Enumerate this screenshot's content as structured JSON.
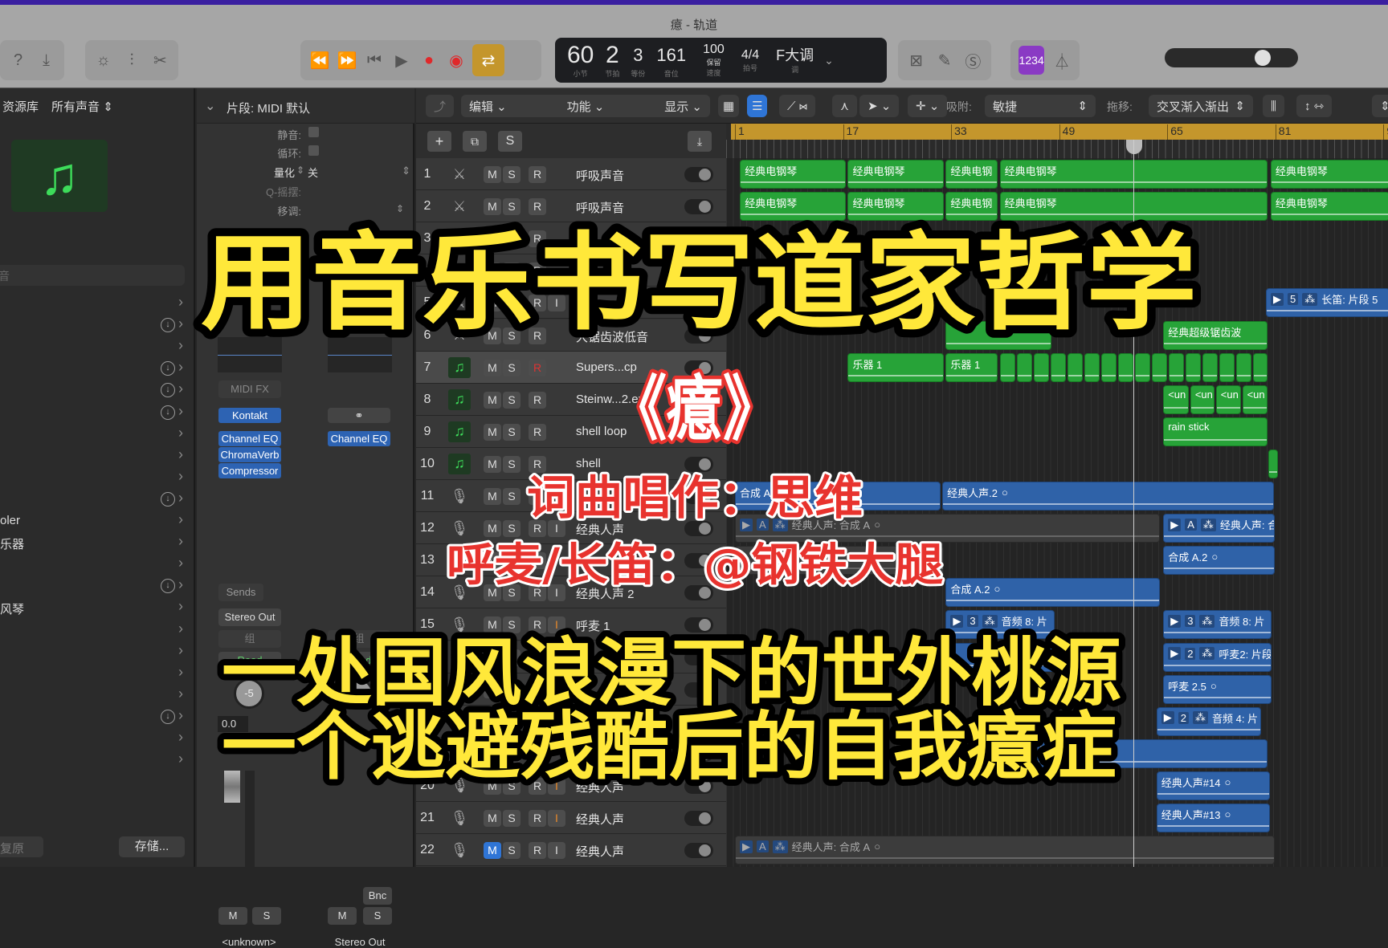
{
  "window": {
    "title": "癔 - 轨道"
  },
  "colors": {
    "accent_green": "#27a338",
    "region_blue": "#2f62a8",
    "cycle_gold": "#c4962c",
    "overlay_yellow": "#ffe83a",
    "overlay_red": "#e8332e"
  },
  "toolbar": {
    "icons": [
      "help-icon",
      "download-icon",
      "brightness-icon",
      "mixer-icon",
      "scissors-icon",
      "rewind-icon",
      "fast-forward-icon",
      "go-to-start-icon",
      "play-icon",
      "record-icon",
      "replace-record-icon",
      "cycle-icon",
      "tuner-icon",
      "pencil-icon",
      "score-icon",
      "count-in-icon",
      "metronome-icon"
    ],
    "count_in": "1234",
    "lcd": {
      "bar": "60",
      "bar_label": "小节",
      "beat": "2",
      "beat_label": "节拍",
      "div": "3",
      "div_label": "等份",
      "tick": "161",
      "tick_label": "音位",
      "tempo": "100",
      "tempo_mode": "保留",
      "tempo_label": "速度",
      "sig_top": "4",
      "sig_bottom": "4",
      "sig_label": "拍号",
      "key": "F大调",
      "key_label": "调"
    },
    "master_volume": 0.7
  },
  "library": {
    "title": "资源库",
    "filter": "所有声音",
    "search_placeholder": "音",
    "items": [
      {
        "label": ""
      },
      {
        "label": ""
      },
      {
        "label": ""
      },
      {
        "label": ""
      },
      {
        "label": ""
      },
      {
        "label": ""
      },
      {
        "label": ""
      },
      {
        "label": ""
      },
      {
        "label": ""
      },
      {
        "label": ""
      },
      {
        "label": "oler"
      },
      {
        "label": "乐器"
      },
      {
        "label": ""
      },
      {
        "label": ""
      },
      {
        "label": "风琴"
      },
      {
        "label": ""
      },
      {
        "label": ""
      },
      {
        "label": ""
      },
      {
        "label": ""
      },
      {
        "label": ""
      },
      {
        "label": ""
      },
      {
        "label": ""
      }
    ],
    "download_rows": [
      1,
      3,
      4,
      5,
      9,
      13,
      19
    ],
    "revert": "复原",
    "save": "存储..."
  },
  "inspector": {
    "region_header": "片段: MIDI 默认",
    "mute": "静音:",
    "loop": "循环:",
    "quantize": "量化",
    "quantize_value": "关",
    "swing": "Q-摇摆:",
    "transpose": "移调:",
    "strip1": {
      "midi_fx": "MIDI FX",
      "instrument": "Kontakt",
      "plugins": [
        "Channel EQ",
        "ChromaVerb",
        "Compressor"
      ],
      "sends": "Sends",
      "output": "Stereo Out",
      "group": "组",
      "automation": "Read",
      "pan": "-5",
      "volume": "0.0",
      "mute": "M",
      "solo": "S",
      "name": "<unknown>"
    },
    "strip2": {
      "plugins": [
        "Channel EQ"
      ],
      "group": "组",
      "automation": "Read",
      "bounce": "Bnc",
      "mute": "M",
      "solo": "S",
      "name": "Stereo Out"
    }
  },
  "local_toolbar": {
    "edit": "编辑",
    "functions": "功能",
    "view": "显示",
    "snap_label": "吸附:",
    "snap": "敏捷",
    "drag_label": "拖移:",
    "drag": "交叉渐入渐出"
  },
  "track_header": {
    "add": "+",
    "solo": "S"
  },
  "ruler": {
    "bars": [
      "1",
      "17",
      "33",
      "49",
      "65",
      "81",
      "9"
    ],
    "playhead_bar": 60
  },
  "tracks": [
    {
      "n": "1",
      "icon": "keyboard",
      "name": "呼吸声音"
    },
    {
      "n": "2",
      "icon": "keyboard",
      "name": "呼吸声音"
    },
    {
      "n": "3",
      "icon": "keyboard",
      "name": ""
    },
    {
      "n": "4",
      "icon": "keyboard",
      "name": ""
    },
    {
      "n": "5",
      "icon": "keyboard",
      "name": "",
      "input": true
    },
    {
      "n": "6",
      "icon": "keyboard",
      "name": "大锯齿波低音"
    },
    {
      "n": "7",
      "icon": "note",
      "name": "Supers...cp",
      "record_red": true,
      "selected": true
    },
    {
      "n": "8",
      "icon": "note",
      "name": "Steinw...2.exs"
    },
    {
      "n": "9",
      "icon": "note",
      "name": "shell loop"
    },
    {
      "n": "10",
      "icon": "note",
      "name": "shell"
    },
    {
      "n": "11",
      "icon": "mic",
      "name": ""
    },
    {
      "n": "12",
      "icon": "mic",
      "name": "经典人声",
      "input": true
    },
    {
      "n": "13",
      "icon": "mic",
      "name": ""
    },
    {
      "n": "14",
      "icon": "mic",
      "name": "经典人声 2",
      "input": true
    },
    {
      "n": "15",
      "icon": "mic",
      "name": "呼麦 1",
      "input": true,
      "input_orange": true
    },
    {
      "n": "16",
      "icon": "mic",
      "name": ""
    },
    {
      "n": "17",
      "icon": "mic",
      "name": ""
    },
    {
      "n": "18",
      "icon": "mic",
      "name": ""
    },
    {
      "n": "19",
      "icon": "mic",
      "name": ""
    },
    {
      "n": "20",
      "icon": "mic",
      "name": "经典人声",
      "input": true,
      "input_orange": true
    },
    {
      "n": "21",
      "icon": "mic",
      "name": "经典人声",
      "input": true,
      "input_orange": true
    },
    {
      "n": "22",
      "icon": "mic",
      "name": "经典人声",
      "input": true,
      "mute_on": true
    }
  ],
  "regions": [
    {
      "t": 1,
      "s": 1.75,
      "e": 17.5,
      "c": "green",
      "label": "经典电钢琴"
    },
    {
      "t": 1,
      "s": 17.7,
      "e": 32,
      "c": "green",
      "label": "经典电钢琴"
    },
    {
      "t": 1,
      "s": 32.2,
      "e": 40,
      "c": "green",
      "label": "经典电钢"
    },
    {
      "t": 1,
      "s": 40.2,
      "e": 80,
      "c": "green",
      "label": "经典电钢琴"
    },
    {
      "t": 1,
      "s": 80.3,
      "e": 98,
      "c": "green",
      "label": "经典电钢琴"
    },
    {
      "t": 2,
      "s": 1.75,
      "e": 17.5,
      "c": "green",
      "label": "经典电钢琴"
    },
    {
      "t": 2,
      "s": 17.7,
      "e": 32,
      "c": "green",
      "label": "经典电钢琴"
    },
    {
      "t": 2,
      "s": 32.2,
      "e": 40,
      "c": "green",
      "label": "经典电钢"
    },
    {
      "t": 2,
      "s": 40.2,
      "e": 80,
      "c": "green",
      "label": "经典电钢琴"
    },
    {
      "t": 2,
      "s": 80.3,
      "e": 98,
      "c": "green",
      "label": "经典电钢琴"
    },
    {
      "t": 5,
      "s": 79.6,
      "e": 98,
      "c": "blue",
      "label": "长笛: 片段 5",
      "badge": "5"
    },
    {
      "t": 6,
      "s": 32.2,
      "e": 48,
      "c": "green",
      "label": ""
    },
    {
      "t": 6,
      "s": 64.4,
      "e": 80,
      "c": "green",
      "label": "经典超级锯齿波"
    },
    {
      "t": 7,
      "s": 17.7,
      "e": 32,
      "c": "green",
      "label": "乐器 1"
    },
    {
      "t": 7,
      "s": 32.2,
      "e": 40,
      "c": "green",
      "label": "乐器 1"
    },
    {
      "t": 7,
      "s": 40.2,
      "e": 42.6,
      "c": "green",
      "label": ""
    },
    {
      "t": 7,
      "s": 42.7,
      "e": 45.1,
      "c": "green",
      "label": ""
    },
    {
      "t": 7,
      "s": 45.2,
      "e": 47.6,
      "c": "green",
      "label": ""
    },
    {
      "t": 7,
      "s": 47.7,
      "e": 50.1,
      "c": "green",
      "label": ""
    },
    {
      "t": 7,
      "s": 50.2,
      "e": 52.6,
      "c": "green",
      "label": ""
    },
    {
      "t": 7,
      "s": 52.7,
      "e": 55.1,
      "c": "green",
      "label": ""
    },
    {
      "t": 7,
      "s": 55.2,
      "e": 57.6,
      "c": "green",
      "label": ""
    },
    {
      "t": 7,
      "s": 57.7,
      "e": 60.1,
      "c": "green",
      "label": ""
    },
    {
      "t": 7,
      "s": 60.2,
      "e": 62.6,
      "c": "green",
      "label": ""
    },
    {
      "t": 7,
      "s": 62.7,
      "e": 65.1,
      "c": "green",
      "label": ""
    },
    {
      "t": 7,
      "s": 65.2,
      "e": 67.6,
      "c": "green",
      "label": ""
    },
    {
      "t": 7,
      "s": 67.7,
      "e": 70.1,
      "c": "green",
      "label": ""
    },
    {
      "t": 7,
      "s": 70.2,
      "e": 72.6,
      "c": "green",
      "label": ""
    },
    {
      "t": 7,
      "s": 72.7,
      "e": 75.1,
      "c": "green",
      "label": ""
    },
    {
      "t": 7,
      "s": 75.2,
      "e": 77.6,
      "c": "green",
      "label": ""
    },
    {
      "t": 7,
      "s": 77.7,
      "e": 80,
      "c": "green",
      "label": ""
    },
    {
      "t": 8,
      "s": 64.4,
      "e": 68.3,
      "c": "green",
      "label": "<un"
    },
    {
      "t": 8,
      "s": 68.4,
      "e": 72.1,
      "c": "green",
      "label": "<un"
    },
    {
      "t": 8,
      "s": 72.2,
      "e": 76,
      "c": "green",
      "label": "<un"
    },
    {
      "t": 8,
      "s": 76.1,
      "e": 80,
      "c": "green",
      "label": "<un"
    },
    {
      "t": 9,
      "s": 64.4,
      "e": 80,
      "c": "green",
      "label": "rain stick"
    },
    {
      "t": 10,
      "s": 80,
      "e": 81.5,
      "c": "green",
      "label": ""
    },
    {
      "t": 11,
      "s": 1,
      "e": 31.6,
      "c": "blue",
      "label": "合成 A."
    },
    {
      "t": 11,
      "s": 31.7,
      "e": 80.9,
      "c": "blue",
      "label": "经典人声.2",
      "circle": true
    },
    {
      "t": 12,
      "s": 1,
      "e": 64,
      "c": "gray",
      "label": "经典人声: 合成 A",
      "badge": "A",
      "circle": true
    },
    {
      "t": 12,
      "s": 64.4,
      "e": 81,
      "c": "blue",
      "label": "经典人声: 合",
      "badge": "A"
    },
    {
      "t": 13,
      "s": 1,
      "e": 32,
      "c": "gray",
      "label": ""
    },
    {
      "t": 13,
      "s": 64.4,
      "e": 81,
      "c": "blue",
      "label": "合成 A.2",
      "circle": true
    },
    {
      "t": 14,
      "s": 32.2,
      "e": 64,
      "c": "blue",
      "label": "合成 A.2",
      "circle": true
    },
    {
      "t": 15,
      "s": 32.2,
      "e": 48.5,
      "c": "blue",
      "label": "音频 8: 片",
      "badge": "3"
    },
    {
      "t": 15,
      "s": 64.4,
      "e": 80.5,
      "c": "blue",
      "label": "音频 8: 片",
      "badge": "3"
    },
    {
      "t": 16,
      "s": 32.2,
      "e": 48.5,
      "c": "blue",
      "label": ""
    },
    {
      "t": 16,
      "s": 64.4,
      "e": 80.5,
      "c": "blue",
      "label": "呼麦2: 片段",
      "badge": "2"
    },
    {
      "t": 17,
      "s": 64.4,
      "e": 80.5,
      "c": "blue",
      "label": "呼麦 2.5",
      "circle": true
    },
    {
      "t": 18,
      "s": 63.4,
      "e": 79,
      "c": "blue",
      "label": "音频 4: 片",
      "badge": "2"
    },
    {
      "t": 19,
      "s": 40,
      "e": 80,
      "c": "blue",
      "label": "音频 4: 片段 2",
      "circle": true
    },
    {
      "t": 20,
      "s": 63.4,
      "e": 80.3,
      "c": "blue",
      "label": "经典人声#14",
      "circle": true
    },
    {
      "t": 21,
      "s": 63.4,
      "e": 80.3,
      "c": "blue",
      "label": "经典人声#13",
      "circle": true
    },
    {
      "t": 22,
      "s": 1,
      "e": 81,
      "c": "gray",
      "label": "经典人声: 合成 A",
      "badge": "A",
      "circle": true
    }
  ],
  "overlay": {
    "headline": "用音乐书写道家哲学",
    "song_title": "《癔》",
    "credit1": "词曲唱作：思维",
    "credit2": "呼麦/长笛：@钢铁大腿",
    "tagline1": "一处国风浪漫下的世外桃源",
    "tagline2": "一个逃避残酷后的自我癔症"
  }
}
